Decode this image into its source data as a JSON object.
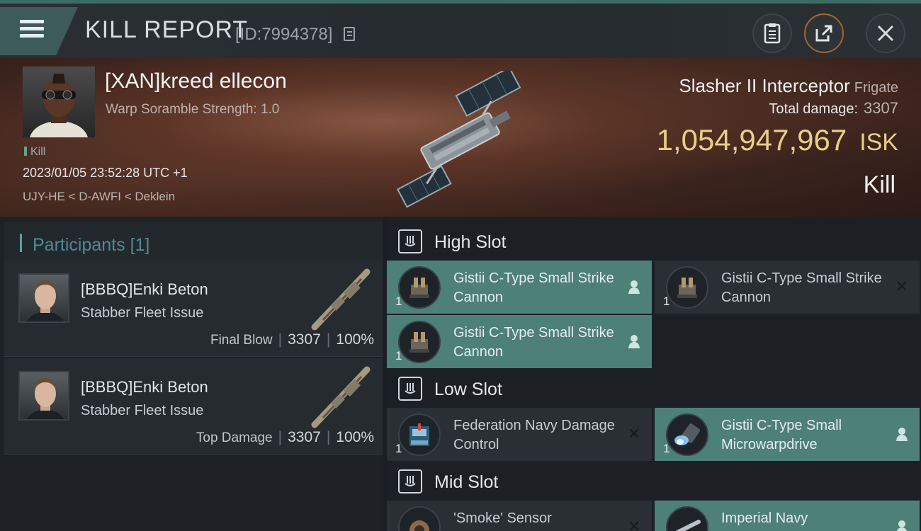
{
  "window": {
    "title": "KILL REPORT",
    "report_id": "[ID:7994378]"
  },
  "victim": {
    "name": "[XAN]kreed ellecon",
    "warp_scramble": "Warp Soramble Strength: 1.0",
    "kill_tag": "Kill",
    "datetime": "2023/01/05 23:52:28 UTC +1",
    "location": "UJY-HE < D-AWFI < Deklein",
    "ship_name": "Slasher II Interceptor",
    "ship_class": "Frigate",
    "total_damage_label": "Total damage:",
    "total_damage_value": "3307",
    "isk_value": "1,054,947,967",
    "isk_unit": "ISK",
    "result": "Kill"
  },
  "participants": {
    "title": "Participants",
    "count": "[1]",
    "items": [
      {
        "name": "[BBBQ]Enki Beton",
        "ship": "Stabber Fleet Issue",
        "role": "Final Blow",
        "damage": "3307",
        "percent": "100%"
      },
      {
        "name": "[BBBQ]Enki Beton",
        "ship": "Stabber Fleet Issue",
        "role": "Top Damage",
        "damage": "3307",
        "percent": "100%"
      }
    ]
  },
  "fitting": {
    "high_slot": {
      "title": "High Slot",
      "modules": [
        {
          "name": "Gistii C-Type Small Strike Cannon",
          "qty": "1",
          "status": "dropped",
          "icon": "cannon-icon"
        },
        {
          "name": "Gistii C-Type Small Strike Cannon",
          "qty": "1",
          "status": "destroyed",
          "icon": "cannon-icon"
        },
        {
          "name": "Gistii C-Type Small Strike Cannon",
          "qty": "1",
          "status": "dropped",
          "icon": "cannon-icon"
        }
      ]
    },
    "low_slot": {
      "title": "Low Slot",
      "modules": [
        {
          "name": "Federation Navy Damage Control",
          "qty": "1",
          "status": "destroyed",
          "icon": "damage-control-icon"
        },
        {
          "name": "Gistii C-Type Small Microwarpdrive",
          "qty": "1",
          "status": "dropped",
          "icon": "microwarpdrive-icon"
        }
      ]
    },
    "mid_slot": {
      "title": "Mid Slot",
      "modules": [
        {
          "name": "'Smoke' Sensor",
          "qty": "1",
          "status": "destroyed",
          "icon": "sensor-icon"
        },
        {
          "name": "Imperial Navy",
          "qty": "1",
          "status": "dropped",
          "icon": "module-icon"
        }
      ]
    }
  },
  "colors": {
    "accent_teal": "#4d8077",
    "isk_gold": "#e8cf86",
    "participants_title": "#4e8b92"
  }
}
